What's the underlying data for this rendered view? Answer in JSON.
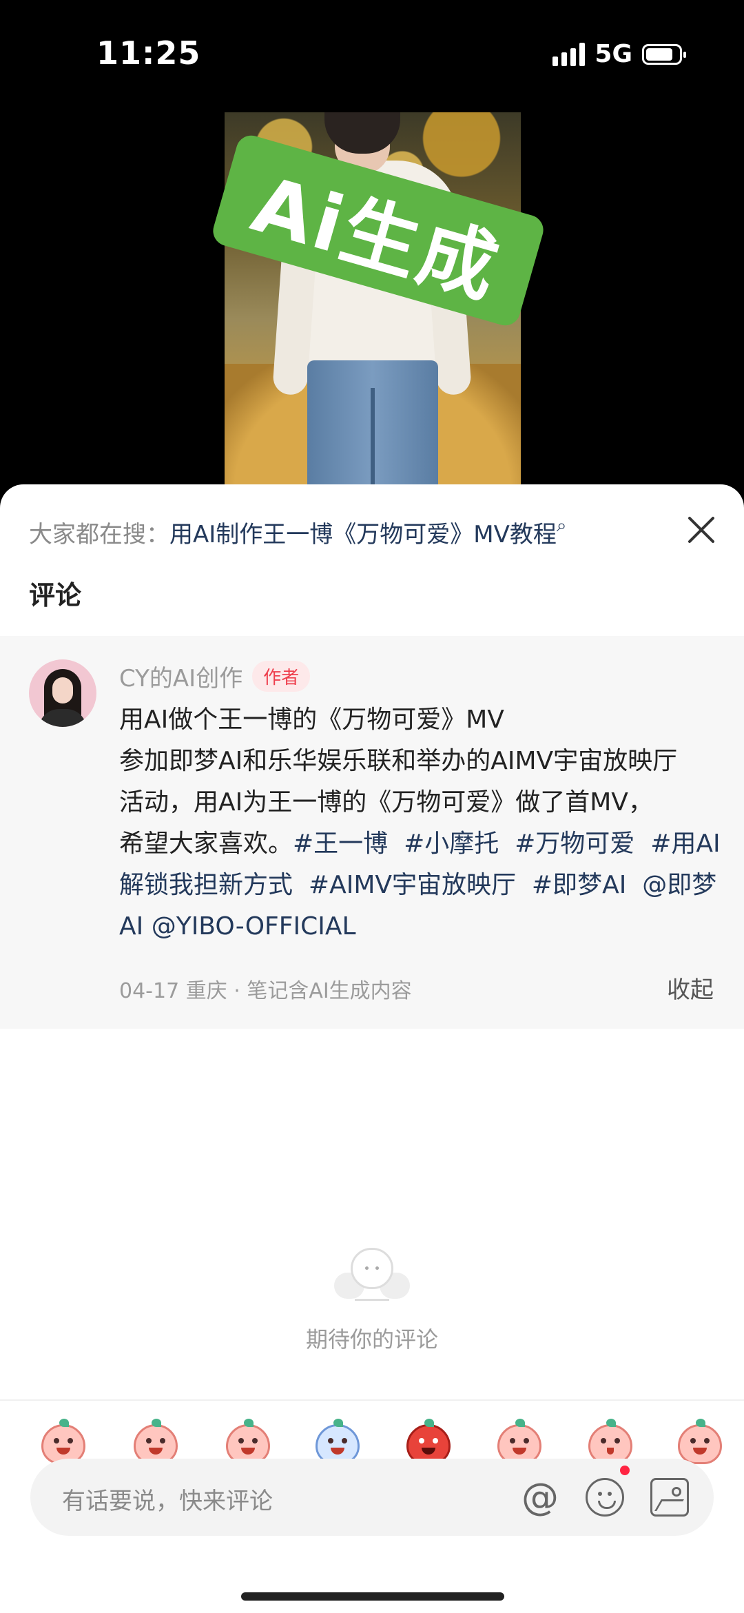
{
  "status_bar": {
    "time": "11:25",
    "network": "5G"
  },
  "media": {
    "stamp_text": "Ai生成"
  },
  "search": {
    "label": "大家都在搜：",
    "query": "用AI制作王一博《万物可爱》MV教程",
    "icon": "search-icon"
  },
  "comments_title": "评论",
  "post": {
    "author": "CY的AI创作",
    "badge": "作者",
    "title": "用AI做个王一博的《万物可爱》MV",
    "line1": "参加即梦AI和乐华娱乐联和举办的AIMV宇宙放映厅",
    "line2": "活动，用AI为王一博的《万物可爱》做了首MV，",
    "line3_text": "希望大家喜欢。",
    "tags": [
      "#王一博",
      "#小摩托",
      "#万物可爱",
      "#用AI解锁我担新方式",
      "#AIMV宇宙放映厅",
      "#即梦AI"
    ],
    "mentions": [
      "@即梦AI",
      "@YIBO-OFFICIAL"
    ],
    "meta": "04-17 重庆 · 笔记含AI生成内容",
    "collapse": "收起"
  },
  "empty_state": {
    "text": "期待你的评论"
  },
  "stickers": [
    "crying-sticker",
    "excited-sticker",
    "surprised-sticker",
    "sobbing-sticker",
    "angry-sticker",
    "teary-sticker",
    "kiss-sticker",
    "sweat-sticker"
  ],
  "input": {
    "placeholder": "有话要说，快来评论",
    "icons": [
      "at-icon",
      "emoji-icon",
      "image-icon"
    ]
  },
  "colors": {
    "tag": "#23395b",
    "badge": "#ee3f4d",
    "notif": "#ff2442",
    "stamp": "#5eb445"
  }
}
